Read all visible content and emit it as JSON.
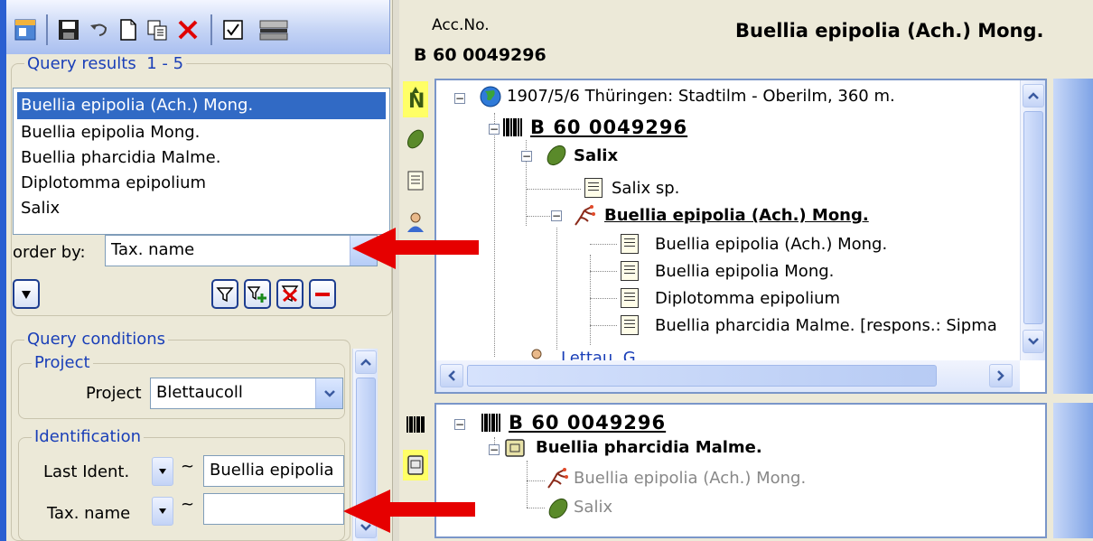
{
  "header": {
    "acc_label": "Acc.No.",
    "acc_value": "B 60 0049296",
    "specimen_title": "Buellia epipolia (Ach.) Mong."
  },
  "query_results": {
    "title": "Query results",
    "range": "1 - 5",
    "items": [
      "Buellia epipolia (Ach.) Mong.",
      "Buellia epipolia Mong.",
      "Buellia pharcidia Malme.",
      "Diplotomma epipolium",
      "Salix"
    ],
    "selected_index": 0,
    "order_by_label": "order by:",
    "order_by_value": "Tax. name"
  },
  "query_conditions": {
    "title": "Query conditions",
    "project_group": "Project",
    "project_label": "Project",
    "project_value": "Blettaucoll",
    "ident_group": "Identification",
    "last_ident_label": "Last Ident.",
    "last_ident_value": "Buellia epipolia",
    "tax_name_label": "Tax. name",
    "tax_name_value": "",
    "op_tilde": "~"
  },
  "upper_tree": {
    "event": "1907/5/6 Thüringen: Stadtilm - Oberilm, 360 m.",
    "barcode": "B 60 0049296",
    "plant_group": "Salix",
    "plant_ident": "Salix sp.",
    "lichen_group": "Buellia epipolia (Ach.) Mong.",
    "lichen_idents": [
      "Buellia epipolia (Ach.) Mong.",
      "Buellia epipolia Mong.",
      "Diplotomma epipolium",
      "Buellia pharcidia Malme.   [respons.: Sipma"
    ],
    "collector": "Lettau, G."
  },
  "lower_tree": {
    "barcode": "B 60 0049296",
    "part": "Buellia pharcidia Malme.",
    "children": [
      "Buellia epipolia (Ach.) Mong.",
      "Salix"
    ]
  },
  "icons": [
    "form-icon",
    "save-icon",
    "undo-icon",
    "new-doc-icon",
    "copy-icon",
    "delete-icon",
    "checkbox-icon",
    "scanner-icon",
    "north-icon",
    "leaf-icon",
    "document-icon",
    "collector-icon",
    "barcode-icon",
    "specimen-part-icon",
    "globe-icon",
    "lichen-icon",
    "filter-icon",
    "add-filter-icon",
    "clear-filter-icon",
    "minus-icon"
  ],
  "colors": {
    "selection": "#316ac5",
    "accent_text": "#1a3fb8",
    "arrow": "#e60000",
    "highlight": "#ffff66"
  }
}
